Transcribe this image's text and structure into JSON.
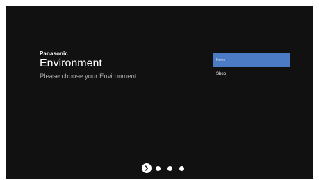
{
  "header": {
    "brand": "Panasonic",
    "title": "Environment",
    "subtitle": "Please choose your Environment"
  },
  "options": [
    {
      "label": "Home",
      "selected": true
    },
    {
      "label": "Shop",
      "selected": false
    }
  ],
  "pager": {
    "total_steps": 4,
    "current_step": 1,
    "active_icon": "chevron-right-icon"
  },
  "colors": {
    "screen_background": "#111111",
    "selected_option": "#4a7bc4",
    "subtitle_text": "#a9a9a9"
  }
}
